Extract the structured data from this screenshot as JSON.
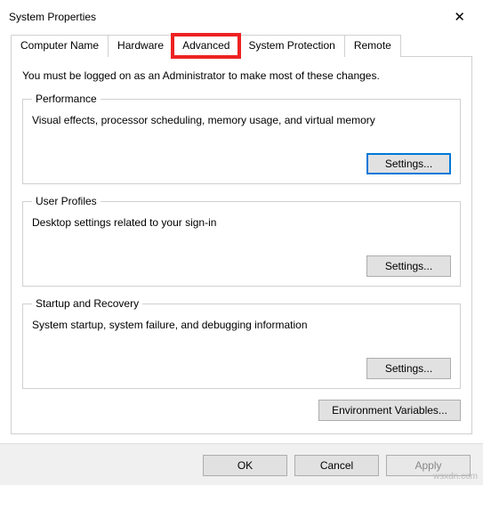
{
  "window": {
    "title": "System Properties",
    "close_glyph": "✕"
  },
  "tabs": [
    {
      "label": "Computer Name"
    },
    {
      "label": "Hardware"
    },
    {
      "label": "Advanced"
    },
    {
      "label": "System Protection"
    },
    {
      "label": "Remote"
    }
  ],
  "active_tab_index": 2,
  "highlighted_tab_index": 2,
  "panel": {
    "intro": "You must be logged on as an Administrator to make most of these changes.",
    "groups": [
      {
        "legend": "Performance",
        "desc": "Visual effects, processor scheduling, memory usage, and virtual memory",
        "button": "Settings...",
        "focused": true
      },
      {
        "legend": "User Profiles",
        "desc": "Desktop settings related to your sign-in",
        "button": "Settings...",
        "focused": false
      },
      {
        "legend": "Startup and Recovery",
        "desc": "System startup, system failure, and debugging information",
        "button": "Settings...",
        "focused": false
      }
    ],
    "env_button": "Environment Variables..."
  },
  "footer": {
    "ok": "OK",
    "cancel": "Cancel",
    "apply": "Apply"
  },
  "watermark": "wsxdn.com"
}
